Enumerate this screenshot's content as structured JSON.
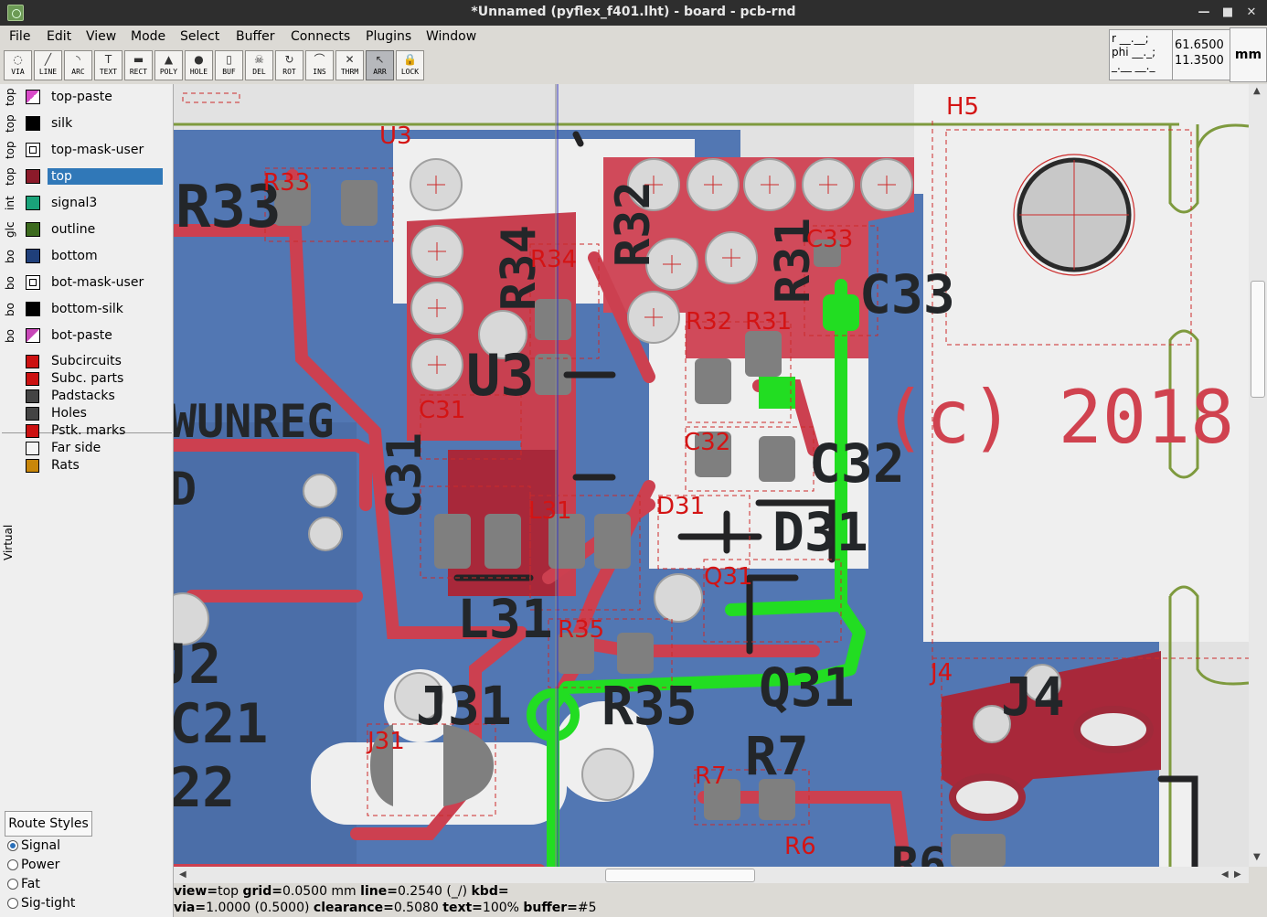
{
  "window": {
    "title": "*Unnamed (pyflex_f401.lht) - board - pcb-rnd",
    "minimize": "—",
    "maximize": "■",
    "close": "✕"
  },
  "menu": [
    "File",
    "Edit",
    "View",
    "Mode",
    "Select",
    "Buffer",
    "Connects",
    "Plugins",
    "Window"
  ],
  "tools": [
    {
      "label": "VIA",
      "icon": "via-icon",
      "glyph": "◌"
    },
    {
      "label": "LINE",
      "icon": "line-icon",
      "glyph": "╱"
    },
    {
      "label": "ARC",
      "icon": "arc-icon",
      "glyph": "◝"
    },
    {
      "label": "TEXT",
      "icon": "text-icon",
      "glyph": "T"
    },
    {
      "label": "RECT",
      "icon": "rect-icon",
      "glyph": "▬"
    },
    {
      "label": "POLY",
      "icon": "poly-icon",
      "glyph": "▲"
    },
    {
      "label": "HOLE",
      "icon": "hole-icon",
      "glyph": "●"
    },
    {
      "label": "BUF",
      "icon": "buffer-icon",
      "glyph": "▯"
    },
    {
      "label": "DEL",
      "icon": "delete-icon",
      "glyph": "☠"
    },
    {
      "label": "ROT",
      "icon": "rotate-icon",
      "glyph": "↻"
    },
    {
      "label": "INS",
      "icon": "insert-icon",
      "glyph": "⌒"
    },
    {
      "label": "THRM",
      "icon": "thermal-icon",
      "glyph": "✕"
    },
    {
      "label": "ARR",
      "icon": "arrow-icon",
      "glyph": "↖"
    },
    {
      "label": "LOCK",
      "icon": "lock-icon",
      "glyph": "🔒"
    }
  ],
  "coords": {
    "rphi": "r __.__;\nphi __._;\n_.__ __._",
    "x": "61.6500",
    "y": "11.3500",
    "unit": "mm"
  },
  "layers": [
    {
      "group": "top",
      "name": "top-paste",
      "color": "#d84ac8",
      "pattern": "diag"
    },
    {
      "group": "top",
      "name": "silk",
      "color": "#000000",
      "pattern": "solid"
    },
    {
      "group": "top",
      "name": "top-mask-user",
      "color": "#ffffff",
      "pattern": "frame"
    },
    {
      "group": "top",
      "name": "top",
      "color": "#8b1a2a",
      "pattern": "solid",
      "selected": true
    },
    {
      "group": "int",
      "name": "signal3",
      "color": "#1aa37a",
      "pattern": "solid"
    },
    {
      "group": "glc",
      "name": "outline",
      "color": "#3c6a1e",
      "pattern": "solid"
    },
    {
      "group": "bo",
      "name": "bottom",
      "color": "#1f3f7a",
      "pattern": "solid"
    },
    {
      "group": "bo",
      "name": "bot-mask-user",
      "color": "#ffffff",
      "pattern": "frame"
    },
    {
      "group": "bo",
      "name": "bottom-silk",
      "color": "#000000",
      "pattern": "solid"
    },
    {
      "group": "bo",
      "name": "bot-paste",
      "color": "#c848b8",
      "pattern": "diag"
    }
  ],
  "virtual": {
    "label": "Virtual",
    "items": [
      {
        "name": "Subcircuits",
        "color": "#cc1111"
      },
      {
        "name": "Subc. parts",
        "color": "#cc1111"
      },
      {
        "name": "Padstacks",
        "color": "#444444"
      },
      {
        "name": "Holes",
        "color": "#444444"
      },
      {
        "name": "Pstk. marks",
        "color": "#cc1111"
      },
      {
        "name": "Far side",
        "color": "#f4f4f4"
      },
      {
        "name": "Rats",
        "color": "#c8860a"
      }
    ]
  },
  "route": {
    "title": "Route Styles",
    "options": [
      {
        "label": "Signal",
        "on": true
      },
      {
        "label": "Power"
      },
      {
        "label": "Fat"
      },
      {
        "label": "Sig-tight"
      }
    ]
  },
  "status": {
    "line1": [
      [
        "view=",
        "top"
      ],
      [
        "grid=",
        "0.0500 mm"
      ],
      [
        "line=",
        "0.2540 (_/)"
      ],
      [
        "kbd=",
        ""
      ]
    ],
    "line2": [
      [
        "via=",
        "1.0000 (0.5000)"
      ],
      [
        "clearance=",
        "0.5080"
      ],
      [
        "text=",
        "100%"
      ],
      [
        "buffer=",
        "#5"
      ]
    ]
  },
  "board_labels": {
    "ref_silk": [
      "R33",
      "R34",
      "R32",
      "R31",
      "C33",
      "U3",
      "C31",
      "C32",
      "D31",
      "Q31",
      "L31",
      "R35",
      "J31",
      "R7",
      "J4",
      "J2",
      "C21",
      "22",
      "WUNREG",
      "D",
      "R6"
    ],
    "ref_red": [
      "U3",
      "R33",
      "R34",
      "C33",
      "R32",
      "R31",
      "C31",
      "C32",
      "L31",
      "D31",
      "Q31",
      "R35",
      "J31",
      "R7",
      "J4",
      "R6",
      "H5"
    ],
    "copyright": "(c) 2018"
  }
}
